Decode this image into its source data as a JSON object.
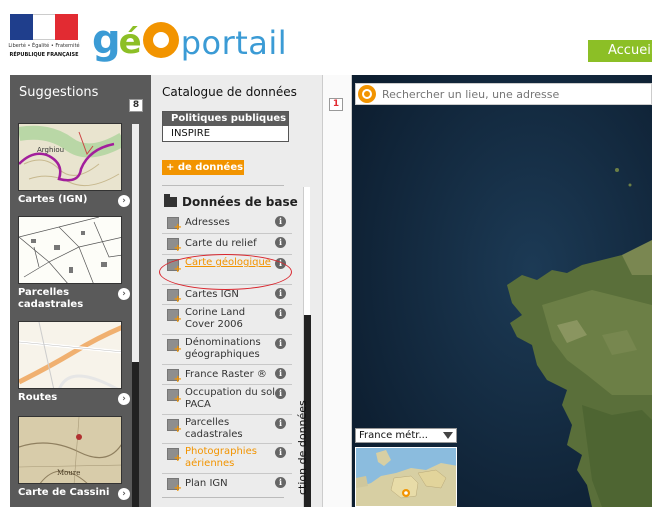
{
  "header": {
    "rf_motto": "Liberté • Égalité • Fraternité",
    "rf_name": "RÉPUBLIQUE FRANÇAISE",
    "logo_g": "g",
    "logo_e": "é",
    "logo_portail": "portail",
    "accueil_label": "Accueil"
  },
  "suggestions": {
    "title": "Suggestions",
    "count": "8",
    "items": [
      {
        "label": "Cartes (IGN)"
      },
      {
        "label": "Parcelles cadastrales"
      },
      {
        "label": "Routes"
      },
      {
        "label": "Carte de Cassini"
      }
    ]
  },
  "catalogue": {
    "title": "Catalogue de données",
    "policies_header": "Politiques publiques",
    "policies_item": "INSPIRE",
    "more_data_label": "+ de données",
    "folder_label": "Données de base",
    "layers": [
      {
        "label": "Adresses"
      },
      {
        "label": "Carte du relief"
      },
      {
        "label": "Carte géologique"
      },
      {
        "label": "Cartes IGN"
      },
      {
        "label": "Corine Land Cover 2006"
      },
      {
        "label": "Dénominations géographiques"
      },
      {
        "label": "France Raster ®"
      },
      {
        "label": "Occupation du sol PACA"
      },
      {
        "label": "Parcelles cadastrales"
      },
      {
        "label": "Photographies aériennes"
      },
      {
        "label": "Plan IGN"
      }
    ],
    "info_glyph": "i"
  },
  "side_panel": {
    "count": "1",
    "label": "ction de données"
  },
  "map": {
    "search_placeholder": "Rechercher un lieu, une adresse",
    "region_selected": "France métr..."
  },
  "colors": {
    "accent_orange": "#f29400",
    "brand_green": "#8cbf26",
    "brand_blue": "#3b9bd5"
  }
}
